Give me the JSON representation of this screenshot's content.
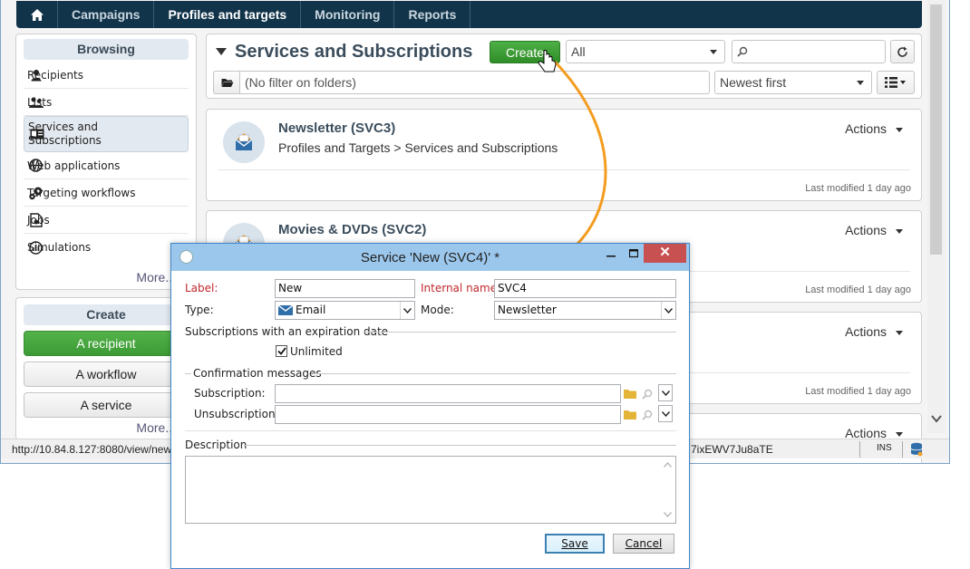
{
  "topnav": {
    "tabs": [
      {
        "label": "Campaigns"
      },
      {
        "label": "Profiles and targets"
      },
      {
        "label": "Monitoring"
      },
      {
        "label": "Reports"
      }
    ]
  },
  "sidebar": {
    "browsing_title": "Browsing",
    "items": [
      {
        "label": "Recipients",
        "icon": "person-icon"
      },
      {
        "label": "Lists",
        "icon": "group-icon"
      },
      {
        "label": "Services and\nSubscriptions",
        "icon": "id-card-icon"
      },
      {
        "label": "Web applications",
        "icon": "globe-icon"
      },
      {
        "label": "Targeting workflows",
        "icon": "gears-icon"
      },
      {
        "label": "Jobs",
        "icon": "job-icon"
      },
      {
        "label": "Simulations",
        "icon": "simulation-icon"
      }
    ],
    "more_label": "More...",
    "create_title": "Create",
    "create_buttons": [
      {
        "label": "A recipient"
      },
      {
        "label": "A workflow"
      },
      {
        "label": "A service"
      }
    ],
    "create_more_label": "More..."
  },
  "content": {
    "title": "Services and Subscriptions",
    "create_button": "Create",
    "filter_select": "All",
    "search_placeholder": "",
    "folder_filter": "(No filter on folders)",
    "sort_select": "Newest first"
  },
  "cards": [
    {
      "title": "Newsletter (SVC3)",
      "path": "Profiles and Targets > Services and Subscriptions",
      "actions": "Actions",
      "modified": "Last modified 1 day ago"
    },
    {
      "title": "Movies & DVDs (SVC2)",
      "path": "",
      "actions": "Actions",
      "modified": "Last modified 1 day ago"
    },
    {
      "title": "",
      "path": "",
      "actions": "Actions",
      "modified": "Last modified 1 day ago"
    },
    {
      "title": "",
      "path": "",
      "actions": "Actions",
      "modified": ""
    }
  ],
  "statusbar": {
    "url": "http://10.84.8.127:8080/view/new",
    "url_tail": "7ixEWV7Ju8aTE",
    "mode": "INS"
  },
  "dialog": {
    "title": "Service 'New (SVC4)' *",
    "label_label": "Label:",
    "label_value": "New",
    "internal_name_label": "Internal name:",
    "internal_name_value": "SVC4",
    "type_label": "Type:",
    "type_value": "Email",
    "mode_label": "Mode:",
    "mode_value": "Newsletter",
    "expiration_section": "Subscriptions with an expiration date",
    "unlimited_label": "Unlimited",
    "unlimited_checked": true,
    "confirmation_section": "Confirmation messages",
    "subscription_label": "Subscription:",
    "subscription_value": "",
    "unsubscription_label": "Unsubscription:",
    "unsubscription_value": "",
    "description_section": "Description",
    "description_value": "",
    "save_label": "Save",
    "cancel_label": "Cancel"
  },
  "colors": {
    "nav_bg": "#12344a",
    "green": "#3c9b34",
    "arrow": "#f39c1f",
    "required": "#c0282b",
    "dialog_titlebar": "#9cc7ec",
    "close_button": "#c75050"
  }
}
